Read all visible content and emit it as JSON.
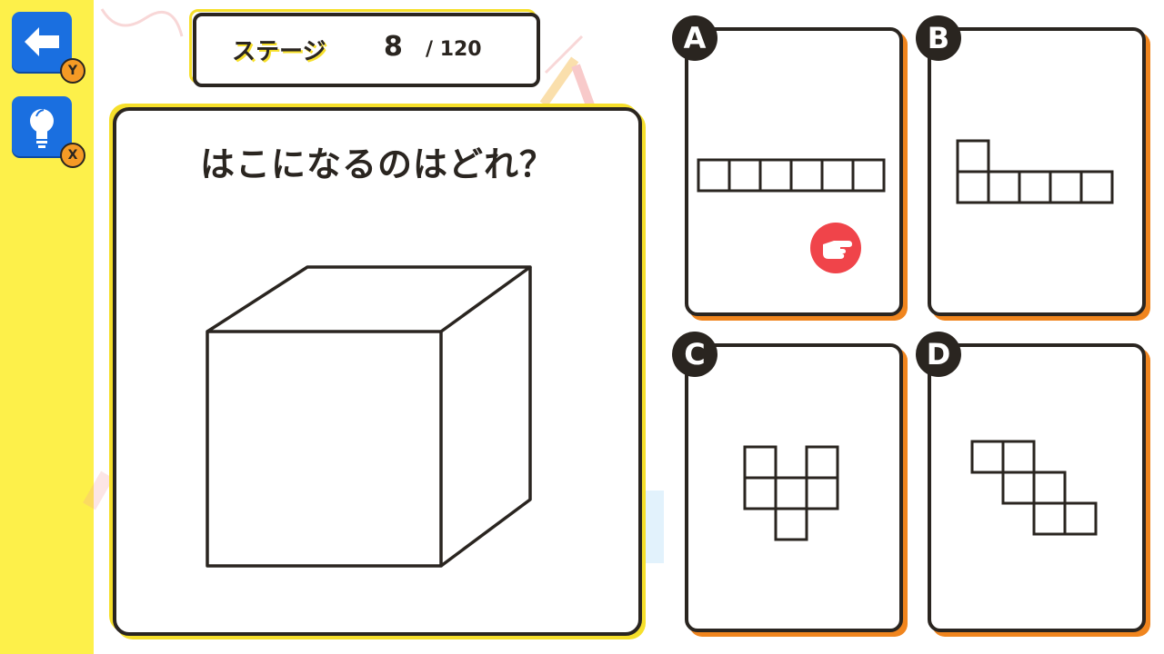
{
  "sidebar": {
    "back_key": "Y",
    "hint_key": "X"
  },
  "stage": {
    "label": "ステージ",
    "current": "8",
    "total": "/ 120"
  },
  "question": {
    "text": "はこになるのはどれ？"
  },
  "choices": [
    {
      "letter": "A",
      "shape": "strip-6"
    },
    {
      "letter": "B",
      "shape": "l-shape-6"
    },
    {
      "letter": "C",
      "shape": "v-shape-6"
    },
    {
      "letter": "D",
      "shape": "staircase-6"
    }
  ],
  "colors": {
    "sidebar_bg": "#fdf04a",
    "button_blue": "#1a6fe0",
    "key_orange": "#f59a25",
    "card_shadow": "#f0851e",
    "pointer_red": "#f0444a",
    "ink": "#2a2520"
  },
  "icons": {
    "back": "arrow-left-icon",
    "hint": "lightbulb-icon",
    "pointer": "pointing-hand-icon"
  }
}
